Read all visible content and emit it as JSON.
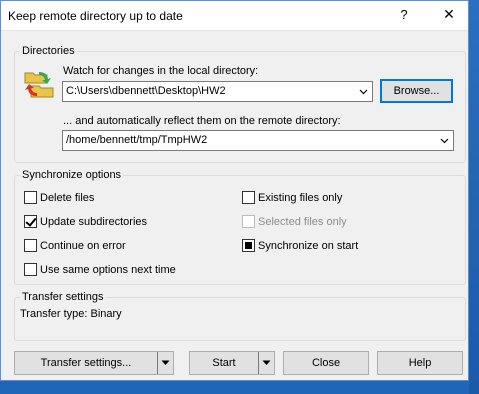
{
  "window": {
    "title": "Keep remote directory up to date",
    "help": "?",
    "close": "✕"
  },
  "directories": {
    "group_label": "Directories",
    "local_label": "Watch for changes in the local directory:",
    "local_value": "C:\\Users\\dbennett\\Desktop\\HW2",
    "browse": "Browse...",
    "remote_label": "... and automatically reflect them on the remote directory:",
    "remote_value": "/home/bennett/tmp/TmpHW2"
  },
  "sync": {
    "group_label": "Synchronize options",
    "delete_files": {
      "label": "Delete files",
      "checked": false
    },
    "update_subdirs": {
      "label": "Update subdirectories",
      "checked": true
    },
    "continue_on_error": {
      "label": "Continue on error",
      "checked": false
    },
    "same_options": {
      "label": "Use same options next time",
      "checked": false
    },
    "existing_only": {
      "label": "Existing files only",
      "checked": false
    },
    "selected_only": {
      "label": "Selected files only",
      "checked": false,
      "disabled": true
    },
    "sync_on_start": {
      "label": "Synchronize on start",
      "state": "indeterminate"
    }
  },
  "transfer": {
    "group_label": "Transfer settings",
    "type_text": "Transfer type: Binary"
  },
  "buttons": {
    "transfer_settings": "Transfer settings...",
    "start": "Start",
    "close": "Close",
    "help": "Help"
  },
  "icons": {
    "folder": "sync-folders-icon",
    "dropdown": "chevron-down-icon"
  }
}
